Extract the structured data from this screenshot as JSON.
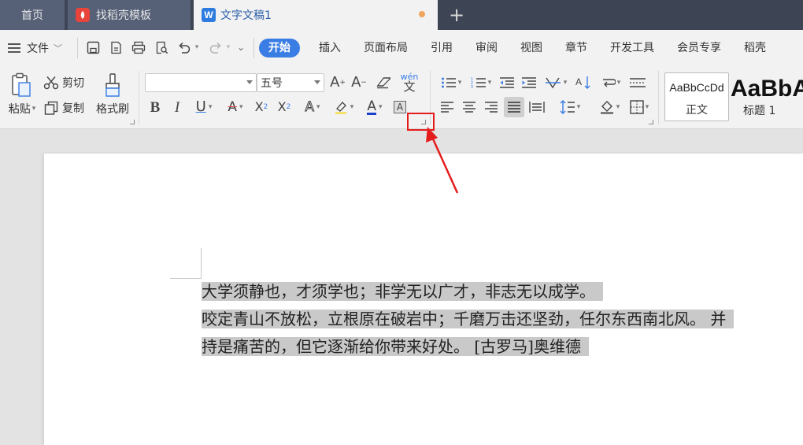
{
  "tabs": {
    "home": "首页",
    "daoke": "找稻壳模板",
    "doc": "文字文稿1",
    "add": "+"
  },
  "menu": {
    "file": "文件",
    "tabs": [
      "开始",
      "插入",
      "页面布局",
      "引用",
      "审阅",
      "视图",
      "章节",
      "开发工具",
      "会员专享",
      "稻壳"
    ],
    "active_tab": "开始"
  },
  "ribbon": {
    "paste": "粘贴",
    "cut": "剪切",
    "copy": "复制",
    "format_painter": "格式刷",
    "font_name": "",
    "font_size": "五号",
    "styles": [
      {
        "sample": "AaBbCcDd",
        "name": "正文"
      },
      {
        "sample": "AaBbA",
        "name": "标题 1"
      }
    ]
  },
  "document": {
    "lines": [
      "大学须静也，才须学也；非学无以广才，非志无以成学。",
      "咬定青山不放松，立根原在破岩中；千磨万击还坚劲，任尔东西南北风。 并",
      "持是痛苦的，但它逐渐给你带来好处。 [古罗马]奥维德"
    ]
  },
  "colors": {
    "accent": "#3a7de4",
    "annotation": "#e51c1c",
    "selection": "#c9c9c9",
    "tabbar": "#3d4454"
  }
}
